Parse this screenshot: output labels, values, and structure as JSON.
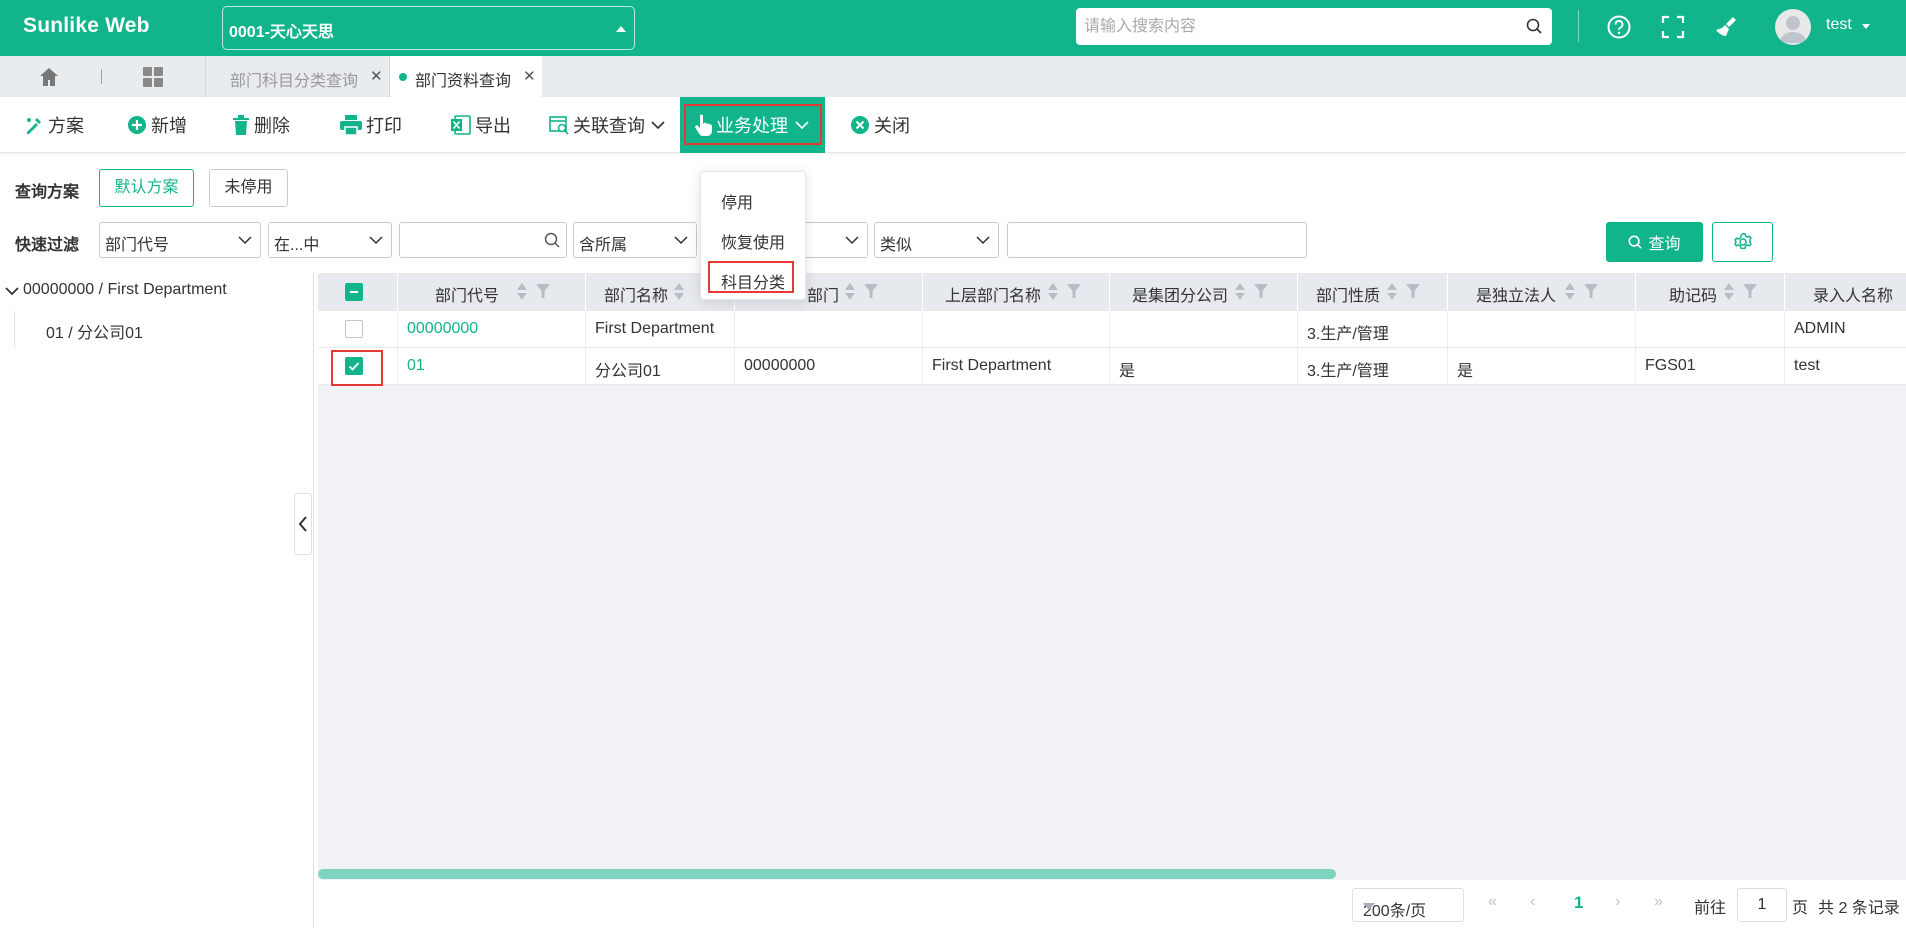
{
  "app": {
    "brand": "Sunlike Web"
  },
  "company_select": {
    "value": "0001-天心天思"
  },
  "global_search": {
    "placeholder": "请输入搜索内容"
  },
  "user": {
    "name": "test"
  },
  "tabs": [
    {
      "label": "部门科目分类查询",
      "active": false
    },
    {
      "label": "部门资料查询",
      "active": true
    }
  ],
  "toolbar": {
    "scheme": "方案",
    "add": "新增",
    "delete": "删除",
    "print": "打印",
    "export": "导出",
    "related_query": "关联查询",
    "business": "业务处理",
    "close": "关闭"
  },
  "business_menu": {
    "items": [
      "停用",
      "恢复使用",
      "科目分类"
    ],
    "highlighted": "科目分类"
  },
  "query": {
    "scheme_label": "查询方案",
    "scheme_default": "默认方案",
    "scheme_inactive": "未停用",
    "filter_label": "快速过滤",
    "field": "部门代号",
    "operator": "在...中",
    "value": "",
    "include": "含所属",
    "field2": "",
    "match": "类似",
    "value2": "",
    "query_button": "查询"
  },
  "tree": {
    "root": "00000000 / First Department",
    "children": [
      "01 / 分公司01"
    ]
  },
  "grid": {
    "columns": [
      "部门代号",
      "部门名称",
      "部门",
      "上层部门名称",
      "是集团分公司",
      "部门性质",
      "是独立法人",
      "助记码",
      "录入人名称"
    ],
    "rows": [
      {
        "checked": false,
        "cells": [
          "00000000",
          "First Department",
          "",
          "",
          "",
          "3.生产/管理",
          "",
          "",
          "ADMIN"
        ]
      },
      {
        "checked": true,
        "cells": [
          "01",
          "分公司01",
          "00000000",
          "First Department",
          "是",
          "3.生产/管理",
          "是",
          "FGS01",
          "test"
        ]
      }
    ]
  },
  "pager": {
    "page_size": "200条/页",
    "current_page": "1",
    "goto_label": "前往",
    "goto_value": "1",
    "page_unit": "页",
    "total": "共 2 条记录"
  },
  "colors": {
    "primary": "#12b48b",
    "highlight": "#e53935"
  }
}
